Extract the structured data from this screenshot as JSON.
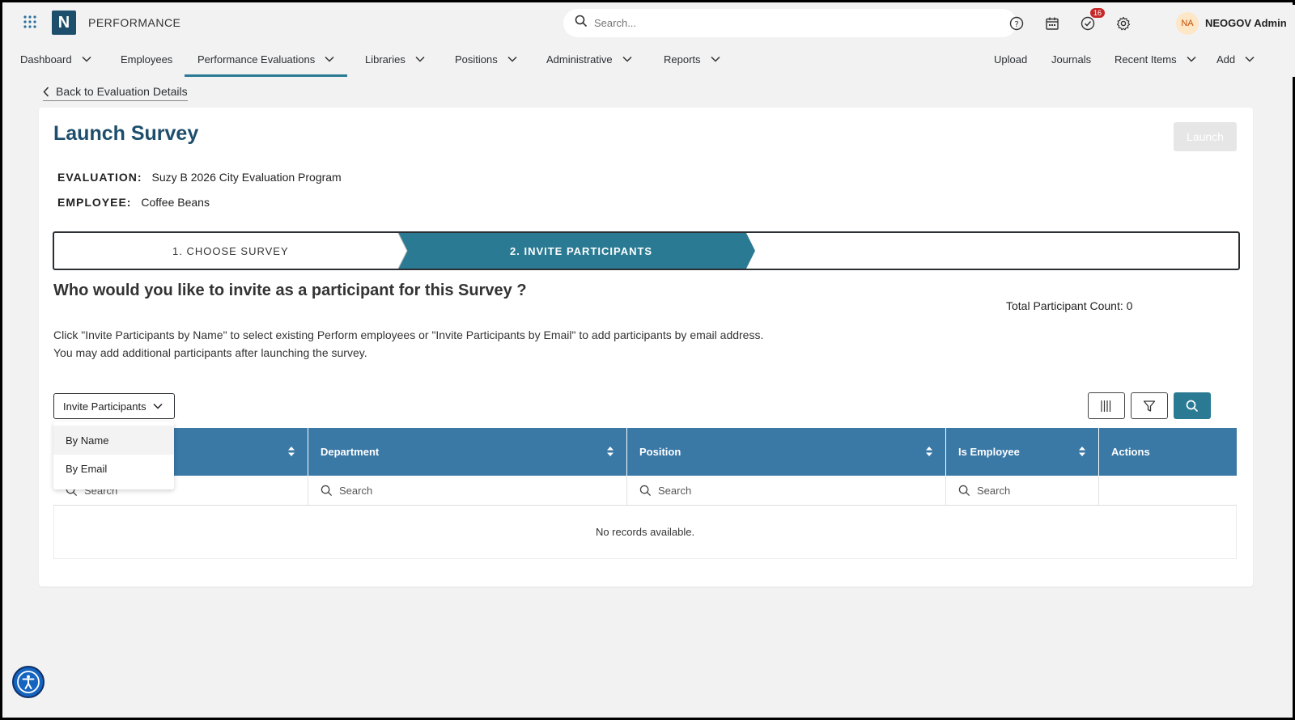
{
  "app": {
    "product_name": "PERFORMANCE",
    "logo_letter": "N",
    "search_placeholder": "Search...",
    "notification_count": "16",
    "user_initials": "NA",
    "user_name": "NEOGOV Admin",
    "accent_color": "#2a7a93",
    "brand_color": "#1d4e6b"
  },
  "nav": {
    "items": [
      {
        "label": "Dashboard",
        "has_menu": true
      },
      {
        "label": "Employees",
        "has_menu": false
      },
      {
        "label": "Performance Evaluations",
        "has_menu": true,
        "active": true
      },
      {
        "label": "Libraries",
        "has_menu": true
      },
      {
        "label": "Positions",
        "has_menu": true
      },
      {
        "label": "Administrative",
        "has_menu": true
      },
      {
        "label": "Reports",
        "has_menu": true
      }
    ],
    "right_items": [
      {
        "label": "Upload",
        "has_menu": false
      },
      {
        "label": "Journals",
        "has_menu": false
      },
      {
        "label": "Recent Items",
        "has_menu": true
      },
      {
        "label": "Add",
        "has_menu": true
      }
    ]
  },
  "breadcrumb": {
    "back_label": "Back to Evaluation Details"
  },
  "page": {
    "title": "Launch Survey",
    "launch_label": "Launch",
    "evaluation_label": "EVALUATION:",
    "evaluation_value": "Suzy B 2026 City Evaluation Program",
    "employee_label": "EMPLOYEE:",
    "employee_value": "Coffee Beans"
  },
  "stepper": {
    "steps": [
      {
        "label": "1. CHOOSE SURVEY",
        "active": false
      },
      {
        "label": "2. INVITE PARTICIPANTS",
        "active": true
      }
    ]
  },
  "invite": {
    "question": "Who would you like to invite as a participant for this Survey ?",
    "total_count_label": "Total Participant Count: 0",
    "instruction_line1": "Click \"Invite Participants by Name\" to select existing Perform employees or \"Invite Participants by Email\" to add participants by email address.",
    "instruction_line2": "You may add additional participants after launching the survey.",
    "button_label": "Invite Participants",
    "menu_options": [
      "By Name",
      "By Email"
    ]
  },
  "table": {
    "columns": [
      "",
      "Department",
      "Position",
      "Is Employee",
      "Actions"
    ],
    "filter_placeholder": "Search",
    "empty_text": "No records available."
  },
  "icons": {
    "apps": "apps-grid-icon",
    "help": "help-icon",
    "calendar": "calendar-icon",
    "tasks": "check-circle-icon",
    "settings": "gear-icon",
    "columns": "columns-icon",
    "filter": "filter-icon",
    "search": "search-icon",
    "accessibility": "accessibility-icon"
  }
}
